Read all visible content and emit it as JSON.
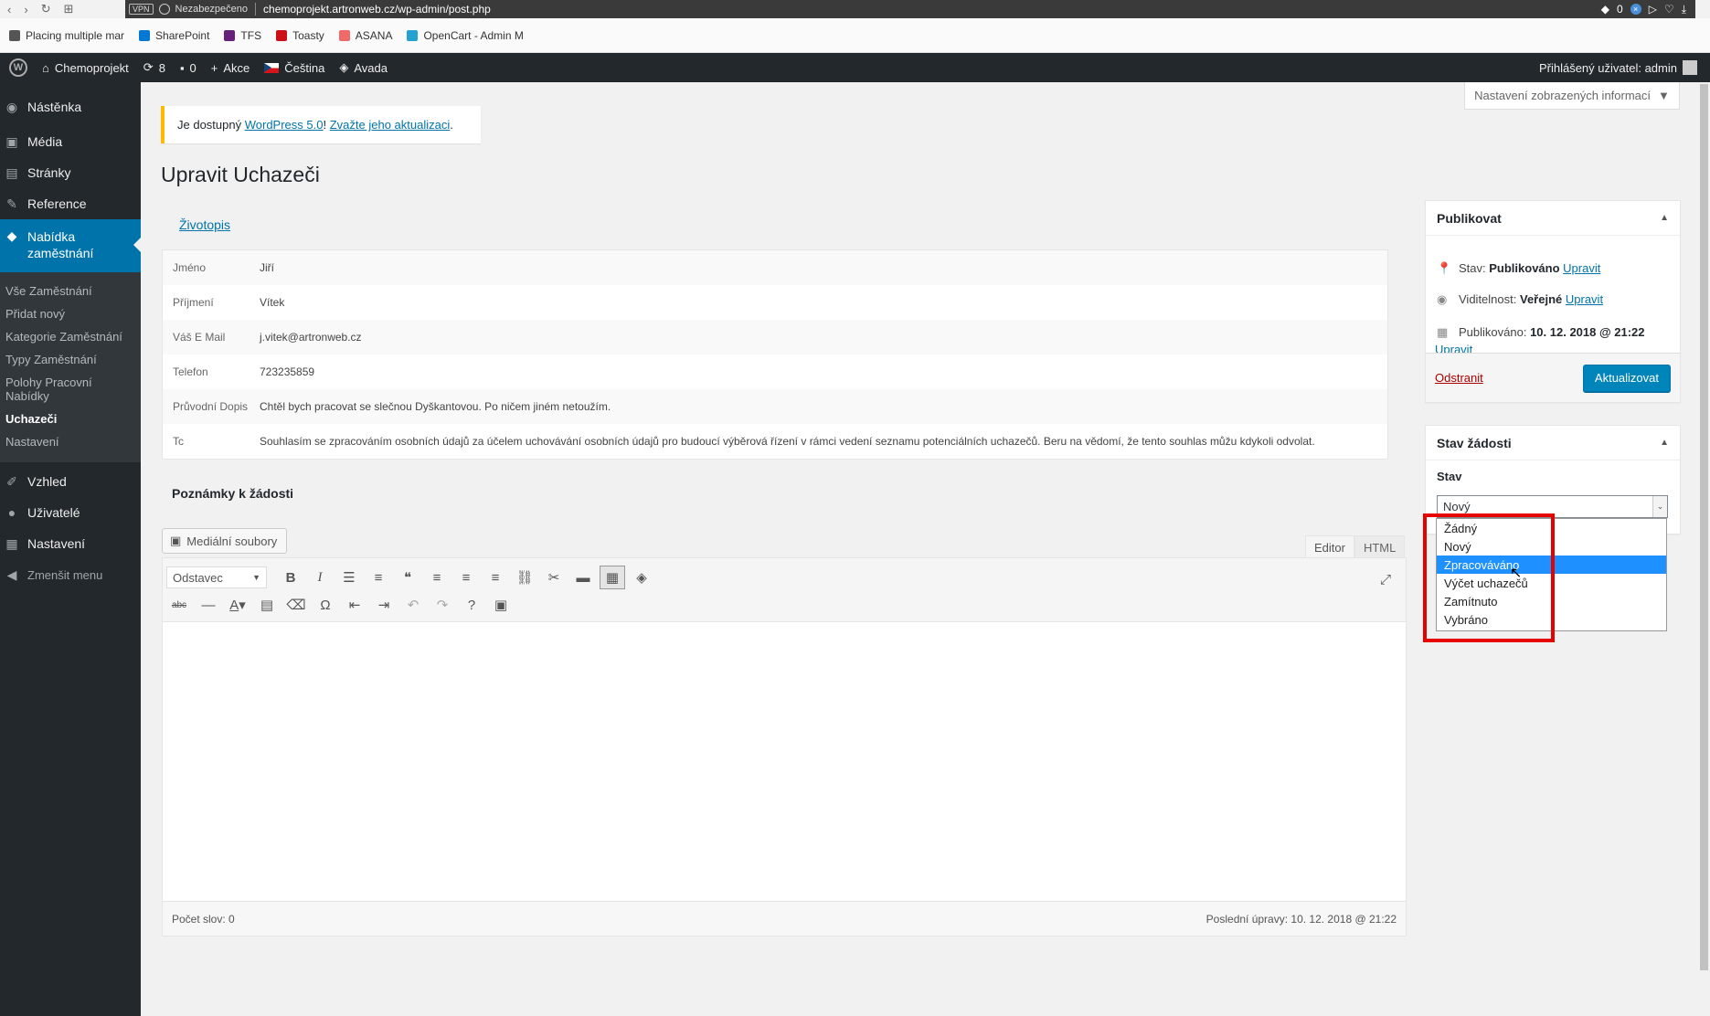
{
  "browser": {
    "vpn": "VPN",
    "insecure": "Nezabezpečeno",
    "url": "chemoprojekt.artronweb.cz/wp-admin/post.php",
    "ext_count": "0"
  },
  "bookmarks": [
    {
      "label": "Placing multiple mar",
      "color": "#555"
    },
    {
      "label": "SharePoint",
      "color": "#0078d4"
    },
    {
      "label": "TFS",
      "color": "#68217a"
    },
    {
      "label": "Toasty",
      "color": "#cc0f16"
    },
    {
      "label": "ASANA",
      "color": "#f06a6a"
    },
    {
      "label": "OpenCart - Admin M",
      "color": "#23a1d1"
    }
  ],
  "adminbar": {
    "site": "Chemoprojekt",
    "updates": "8",
    "comments": "0",
    "new": "Akce",
    "lang": "Čeština",
    "theme": "Avada",
    "user": "Přihlášený uživatel: admin"
  },
  "sidebar": {
    "dashboard": "Nástěnka",
    "media": "Média",
    "pages": "Stránky",
    "reference": "Reference",
    "jobs": "Nabídka zaměstnání",
    "sub": [
      "Vše Zaměstnání",
      "Přidat nový",
      "Kategorie Zaměstnání",
      "Typy Zaměstnání",
      "Polohy Pracovní Nabídky",
      "Uchazeči",
      "Nastavení"
    ],
    "appearance": "Vzhled",
    "users": "Uživatelé",
    "settings": "Nastavení",
    "collapse": "Zmenšit menu"
  },
  "screen_options": "Nastavení zobrazených informací",
  "notice": {
    "prefix": "Je dostupný",
    "link1": "WordPress 5.0",
    "sep": "!",
    "link2": "Zvažte jeho aktualizaci",
    "suffix": "."
  },
  "page_title": "Upravit Uchazeči",
  "cv_link": "Životopis",
  "applicant": [
    {
      "label": "Jméno",
      "value": "Jiří"
    },
    {
      "label": "Příjmení",
      "value": "Vítek"
    },
    {
      "label": "Váš E Mail",
      "value": "j.vitek@artronweb.cz"
    },
    {
      "label": "Telefon",
      "value": "723235859"
    },
    {
      "label": "Průvodní Dopis",
      "value": "Chtěl bych pracovat se slečnou Dyškantovou. Po ničem jiném netoužím."
    },
    {
      "label": "Tc",
      "value": "Souhlasím se zpracováním osobních údajů za účelem uchovávání osobních údajů pro budoucí výběrová řízení v rámci vedení seznamu potenciálních uchazečů. Beru na vědomí, že tento souhlas můžu kdykoli odvolat."
    }
  ],
  "notes_title": "Poznámky k žádosti",
  "editor": {
    "media_button": "Mediální soubory",
    "tab_visual": "Editor",
    "tab_html": "HTML",
    "format": "Odstavec",
    "word_count": "Počet slov: 0",
    "last_edit": "Poslední úpravy: 10. 12. 2018 @ 21:22"
  },
  "publish": {
    "title": "Publikovat",
    "status_label": "Stav:",
    "status_value": "Publikováno",
    "visibility_label": "Viditelnost:",
    "visibility_value": "Veřejné",
    "published_label": "Publikováno:",
    "published_value": "10. 12. 2018 @ 21:22",
    "edit": "Upravit",
    "delete": "Odstranit",
    "update": "Aktualizovat"
  },
  "request_status": {
    "title": "Stav žádosti",
    "label": "Stav",
    "selected": "Nový",
    "options": [
      "Žádný",
      "Nový",
      "Zpracováváno",
      "Výčet uchazečů",
      "Zamítnuto",
      "Vybráno"
    ],
    "highlighted_index": 2
  }
}
